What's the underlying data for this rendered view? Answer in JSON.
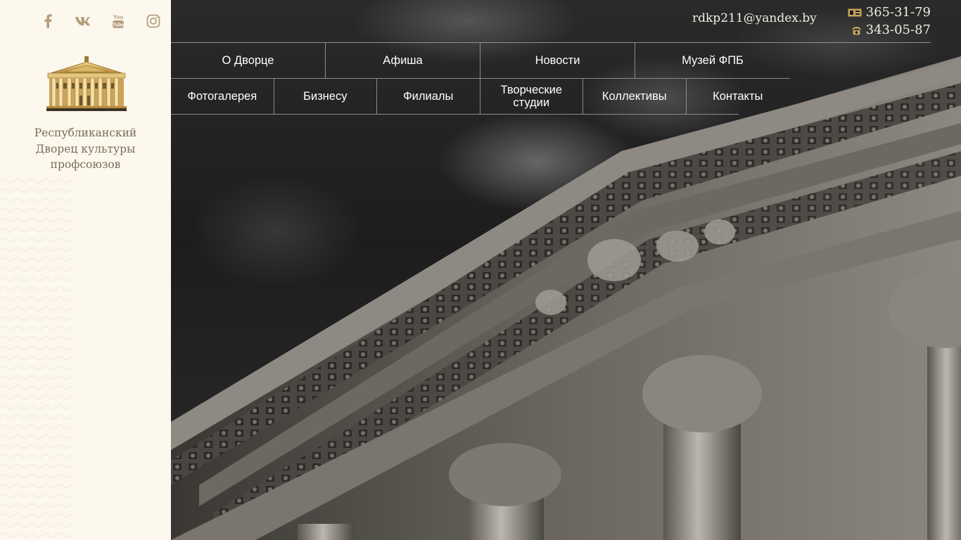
{
  "social": [
    {
      "name": "facebook-icon"
    },
    {
      "name": "vk-icon"
    },
    {
      "name": "youtube-icon"
    },
    {
      "name": "instagram-icon"
    }
  ],
  "org": {
    "name_line1": "Республиканский",
    "name_line2": "Дворец культуры",
    "name_line3": "профсоюзов"
  },
  "contacts": {
    "email": "rdkp211@yandex.by",
    "phone1": "365-31-79",
    "phone2": "343-05-87",
    "phone1_icon": "fax-icon",
    "phone2_icon": "phone-icon"
  },
  "nav": {
    "row1": [
      {
        "label": "О Дворце"
      },
      {
        "label": "Афиша"
      },
      {
        "label": "Новости"
      },
      {
        "label": "Музей ФПБ"
      }
    ],
    "row2": [
      {
        "label": "Фотогалерея"
      },
      {
        "label": "Бизнесу"
      },
      {
        "label": "Филиалы"
      },
      {
        "label": "Творческие студии"
      },
      {
        "label": "Коллективы"
      },
      {
        "label": "Контакты"
      }
    ]
  },
  "colors": {
    "sidebar_bg": "#fdf8ee",
    "social_icon": "#b49e7d",
    "org_text": "#7b6b57",
    "gold": "#c9a45a",
    "nav_text": "#ffffff"
  }
}
